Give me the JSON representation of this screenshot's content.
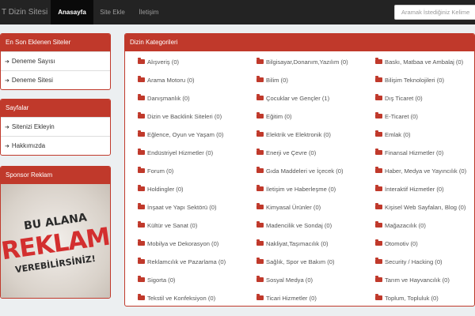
{
  "navbar": {
    "brand": "T Dizin Sitesi",
    "items": [
      {
        "label": "Anasayfa",
        "active": true
      },
      {
        "label": "Site Ekle",
        "active": false
      },
      {
        "label": "İletişim",
        "active": false
      }
    ],
    "search_placeholder": "Aramak İstediğiniz Kelime"
  },
  "sidebar": {
    "recent": {
      "title": "En Son Eklenen Siteler",
      "items": [
        "Deneme Sayısı",
        "Deneme Sitesi"
      ]
    },
    "pages": {
      "title": "Sayfalar",
      "items": [
        "Sitenizi Ekleyin",
        "Hakkımızda"
      ]
    },
    "sponsor": {
      "title": "Sponsor Reklam",
      "ad_line1": "BU ALANA",
      "ad_line2": "REKLAM",
      "ad_line3": "VEREBİLİRSİNİZ!"
    }
  },
  "categories": {
    "title": "Dizin Kategorileri",
    "columns": [
      [
        "Alışveriş (0)",
        "Arama Motoru (0)",
        "Danışmanlık (0)",
        "Dizin ve Backlink Siteleri (0)",
        "Eğlence, Oyun ve Yaşam (0)",
        "Endüstriyel Hizmetler (0)",
        "Forum (0)",
        "Holdingler (0)",
        "İnşaat ve Yapı Sektörü (0)",
        "Kültür ve Sanat (0)",
        "Mobilya ve Dekorasyon (0)",
        "Reklamcılık ve Pazarlama (0)",
        "Sigorta (0)",
        "Tekstil ve Konfeksiyon (0)"
      ],
      [
        "Bilgisayar,Donanım,Yazılım (0)",
        "Bilim (0)",
        "Çocuklar ve Gençler (1)",
        "Eğitim (0)",
        "Elektrik ve Elektronik (0)",
        "Enerji ve Çevre (0)",
        "Gıda Maddeleri ve İçecek (0)",
        "İletişim ve Haberleşme (0)",
        "Kimyasal Ürünler (0)",
        "Madencilik ve Sondaj (0)",
        "Nakliyat,Taşımacılık (0)",
        "Sağlık, Spor ve Bakım (0)",
        "Sosyal Medya (0)",
        "Ticari Hizmetler (0)"
      ],
      [
        "Baskı, Matbaa ve Ambalaj (0)",
        "Bilişim Teknolojileri (0)",
        "Dış Ticaret (0)",
        "E-Ticaret (0)",
        "Emlak (0)",
        "Finansal Hizmetler (0)",
        "Haber, Medya ve Yayıncılık (0)",
        "İnteraktif Hizmetler (0)",
        "Kişisel Web Sayfaları, Blog (0)",
        "Mağazacılık (0)",
        "Otomotiv (0)",
        "Security / Hacking (0)",
        "Tarım ve Hayvancılık (0)",
        "Toplum, Topluluk (0)"
      ]
    ]
  },
  "colors": {
    "accent": "#c0392b",
    "navbar": "#232323"
  }
}
